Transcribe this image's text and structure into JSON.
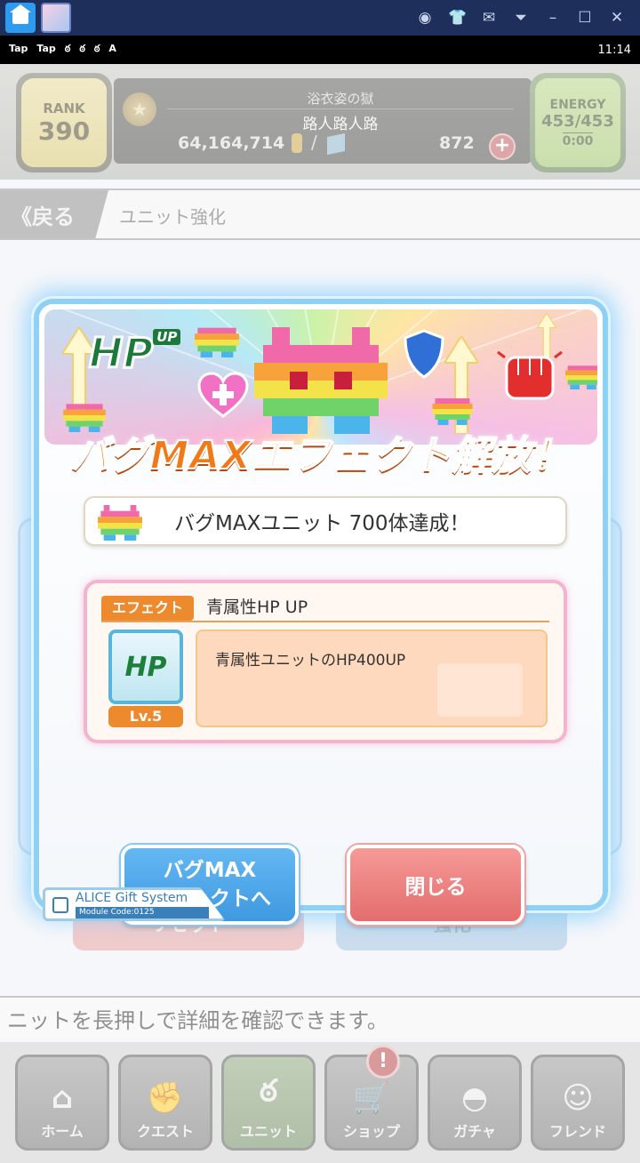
{
  "status_bar": {
    "left_icons": [
      "Tap",
      "Tap",
      "ఠ",
      "ఠ",
      "ఠ",
      "A"
    ],
    "time": "11:14"
  },
  "header": {
    "rank_label": "RANK",
    "rank_value": "390",
    "title": "浴衣姿の獄",
    "player_name": "路人路人路",
    "coins": "64,164,714",
    "slash": "/",
    "gems": "872",
    "plus": "+",
    "energy_label": "ENERGY",
    "energy_value": "453/453",
    "energy_timer": "0:00"
  },
  "subbar": {
    "back_label": "《戻る",
    "title": "ユニット強化"
  },
  "background": {
    "reset_button": "リセット",
    "power_button": "強化",
    "hint": "ニットを長押しで詳細を確認できます。"
  },
  "nav": {
    "items": [
      {
        "label": "ホーム",
        "icon": "home-icon",
        "glyph": "⌂"
      },
      {
        "label": "クエスト",
        "icon": "handshake-icon",
        "glyph": "✊"
      },
      {
        "label": "ユニット",
        "icon": "bunny-icon",
        "glyph": "ఠ"
      },
      {
        "label": "ショップ",
        "icon": "cart-icon",
        "glyph": "🛒"
      },
      {
        "label": "ガチャ",
        "icon": "egg-icon",
        "glyph": "◓"
      },
      {
        "label": "フレンド",
        "icon": "friends-icon",
        "glyph": "☺"
      }
    ],
    "shop_badge": "!"
  },
  "modal": {
    "banner_hp": "HP",
    "banner_hp_up": "UP",
    "title": "バグMAXエフェクト解放！",
    "achievement": "バグMAXユニット 700体達成！",
    "effect_tag": "エフェクト",
    "effect_name": "青属性HP UP",
    "effect_icon_text": "HP",
    "effect_level": "Lv.5",
    "effect_description": "青属性ユニットのHP400UP",
    "bugmax_button_line1": "バグMAX",
    "bugmax_button_line2": "エフェクトへ",
    "close_button": "閉じる",
    "system_name": "ALICE Gift System",
    "module_code": "Module Code:0125"
  },
  "colors": {
    "title_orange": "#f07a17",
    "effect_orange": "#ee8a2e",
    "button_blue": "#4aa6e8",
    "button_red": "#e87474",
    "modal_glow": "#8fd0f5"
  }
}
